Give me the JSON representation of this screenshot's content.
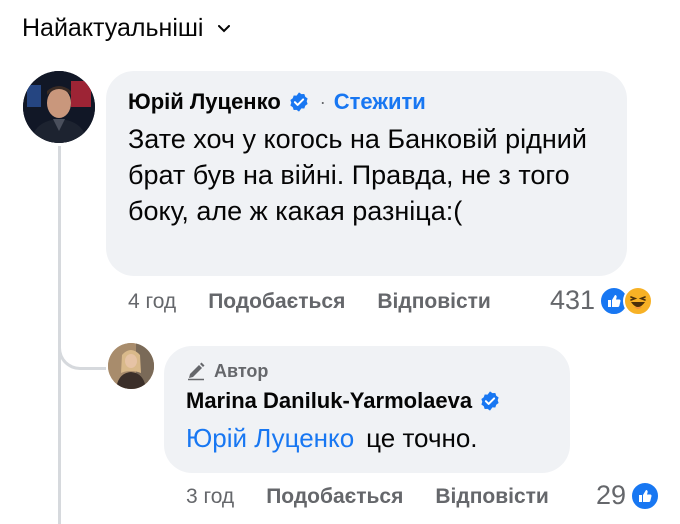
{
  "sort": {
    "label": "Найактуальніші"
  },
  "comment": {
    "author": "Юрій Луценко",
    "separator": "·",
    "follow_label": "Стежити",
    "text": "Зате хоч у когось на Банковій рідний брат був на війні. Правда, не з того боку, але ж какая разніца:(",
    "time": "4 год",
    "like_label": "Подобається",
    "reply_label": "Відповісти",
    "reaction_count": "431"
  },
  "reply": {
    "badge": "Автор",
    "author": "Marina Daniluk-Yarmolaeva",
    "mention": "Юрій Луценко",
    "text": "це точно.",
    "time": "3 год",
    "like_label": "Подобається",
    "reply_label": "Відповісти",
    "reaction_count": "29"
  },
  "colors": {
    "link": "#1877f2",
    "bubble": "#f0f2f5",
    "muted": "#65676b"
  },
  "icons": [
    "chevron-down-icon",
    "verified-icon",
    "pencil-icon",
    "like-reaction-icon",
    "haha-reaction-icon"
  ]
}
